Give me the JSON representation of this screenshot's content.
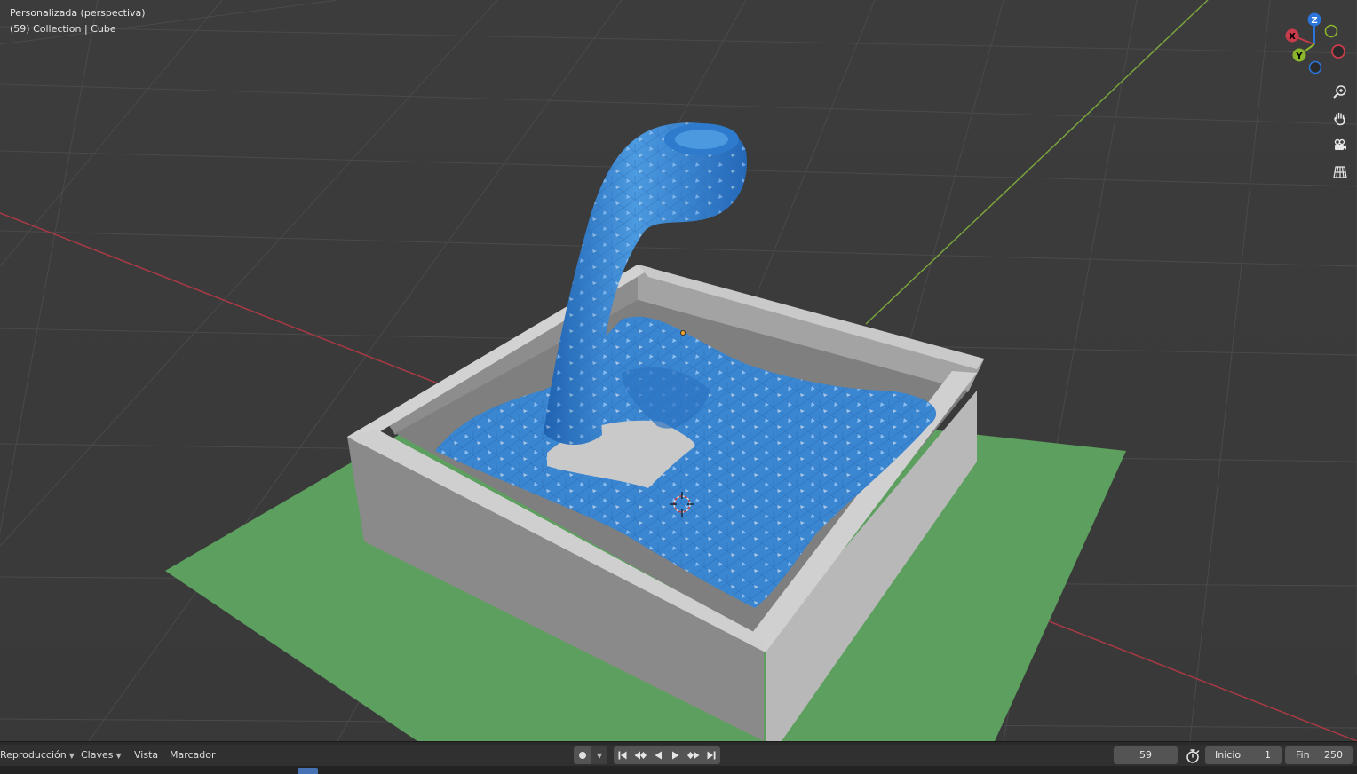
{
  "viewport": {
    "view_name": "Personalizada (perspectiva)",
    "object_info": "(59) Collection | Cube"
  },
  "gizmo": {
    "z_label": "Z",
    "x_label": "X",
    "y_label": "Y",
    "colors": {
      "x": "#c83c4b",
      "y": "#8ab52c",
      "z": "#2b74d9"
    }
  },
  "nav_icons": [
    "zoom-icon",
    "hand-icon",
    "camera-icon",
    "grid-icon"
  ],
  "timeline": {
    "menus": {
      "playback": "Reproducción",
      "keying": "Claves",
      "view": "Vista",
      "marker": "Marcador"
    },
    "current_frame": "59",
    "start_label": "Inicio",
    "start_value": "1",
    "end_label": "Fin",
    "end_value": "250"
  },
  "colors": {
    "background": "#3b3b3b",
    "plane": "#5c9f5e",
    "container": "#b4b4b4",
    "fluid": "#3b86d0",
    "x_axis": "#a83a45",
    "y_axis": "#7aa33d"
  }
}
